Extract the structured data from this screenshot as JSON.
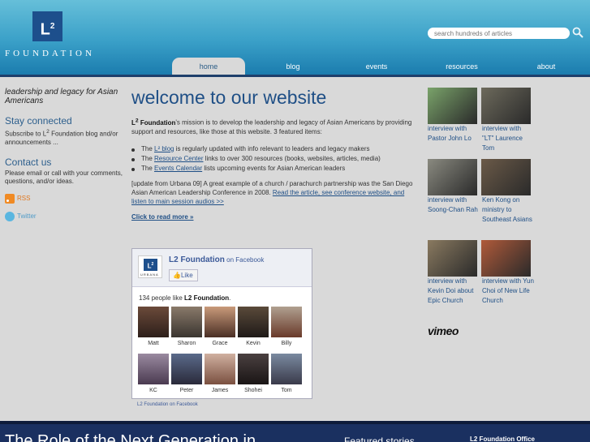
{
  "header": {
    "logo_mark": "L",
    "logo_sup": "2",
    "logo_text": "FOUNDATION",
    "search_placeholder": "search hundreds of articles"
  },
  "nav": [
    {
      "label": "home",
      "active": true
    },
    {
      "label": "blog"
    },
    {
      "label": "events"
    },
    {
      "label": "resources"
    },
    {
      "label": "about"
    }
  ],
  "sidebar": {
    "tagline": "leadership and legacy for Asian Americans",
    "stay_connected": {
      "heading": "Stay connected",
      "text_before": "Subscribe to L",
      "sup": "2",
      "text_after": " Foundation blog and/or announcements ..."
    },
    "contact": {
      "heading": "Contact us",
      "text": "Please email or call with your comments, questions, and/or ideas."
    },
    "rss_label": "RSS",
    "twitter_label": "Twitter"
  },
  "main": {
    "title": "welcome to our website",
    "intro_bold": "L",
    "intro_bold_sup": "2",
    "intro_bold_rest": " Foundation",
    "intro_rest": "'s mission is to develop the leadership and legacy of Asian Americans by providing support and resources, like those at this website. 3 featured items:",
    "bullets": [
      {
        "pre": "The ",
        "link": "L² blog",
        "post": " is regularly updated with info relevant to leaders and legacy makers"
      },
      {
        "pre": "The ",
        "link": "Resource Center",
        "post": " links to over 300 resources (books, websites, articles, media)"
      },
      {
        "pre": "The ",
        "link": "Events Calendar",
        "post": " lists upcoming events for Asian American leaders"
      }
    ],
    "update_text": "[update from Urbana 09] A great example of a church / parachurch partnership was the San Diego Asian American Leadership Conference in 2008. ",
    "update_link": "Read the article, see conference website, and listen to main session audios >>",
    "read_more": "Click to read more »"
  },
  "facebook": {
    "page_name": "L2 Foundation",
    "on_facebook": " on Facebook",
    "like_label": "Like",
    "logo_caption": "URBANA",
    "count_text": "134 people like ",
    "count_bold": "L2 Foundation",
    "count_end": ".",
    "faces": [
      "Matt",
      "Sharon",
      "Grace",
      "Kevin",
      "Billy",
      "KC",
      "Peter",
      "James",
      "Shohei",
      "Tom"
    ],
    "footer": "L2 Foundation on Facebook"
  },
  "videos": [
    {
      "caption": "interview with Pastor John Lo",
      "color": "#7aa36a"
    },
    {
      "caption": "interview with \"LT\" Laurence Tom",
      "color": "#6d6a5c"
    },
    {
      "caption": "interview with Soong-Chan Rah",
      "color": "#8a8a80"
    },
    {
      "caption": "Ken Kong on ministry to Southeast Asians",
      "color": "#6b5a48"
    },
    {
      "caption": "interview with Kevin Doi about Epic Church",
      "color": "#8a7a60"
    },
    {
      "caption": "interview with Yun Choi of New Life Church",
      "color": "#b05a3a"
    }
  ],
  "vimeo_label": "vimeo",
  "bottom": {
    "headline": "The Role of the Next Generation in",
    "featured": "Featured stories",
    "office": "L2 Foundation Office"
  }
}
